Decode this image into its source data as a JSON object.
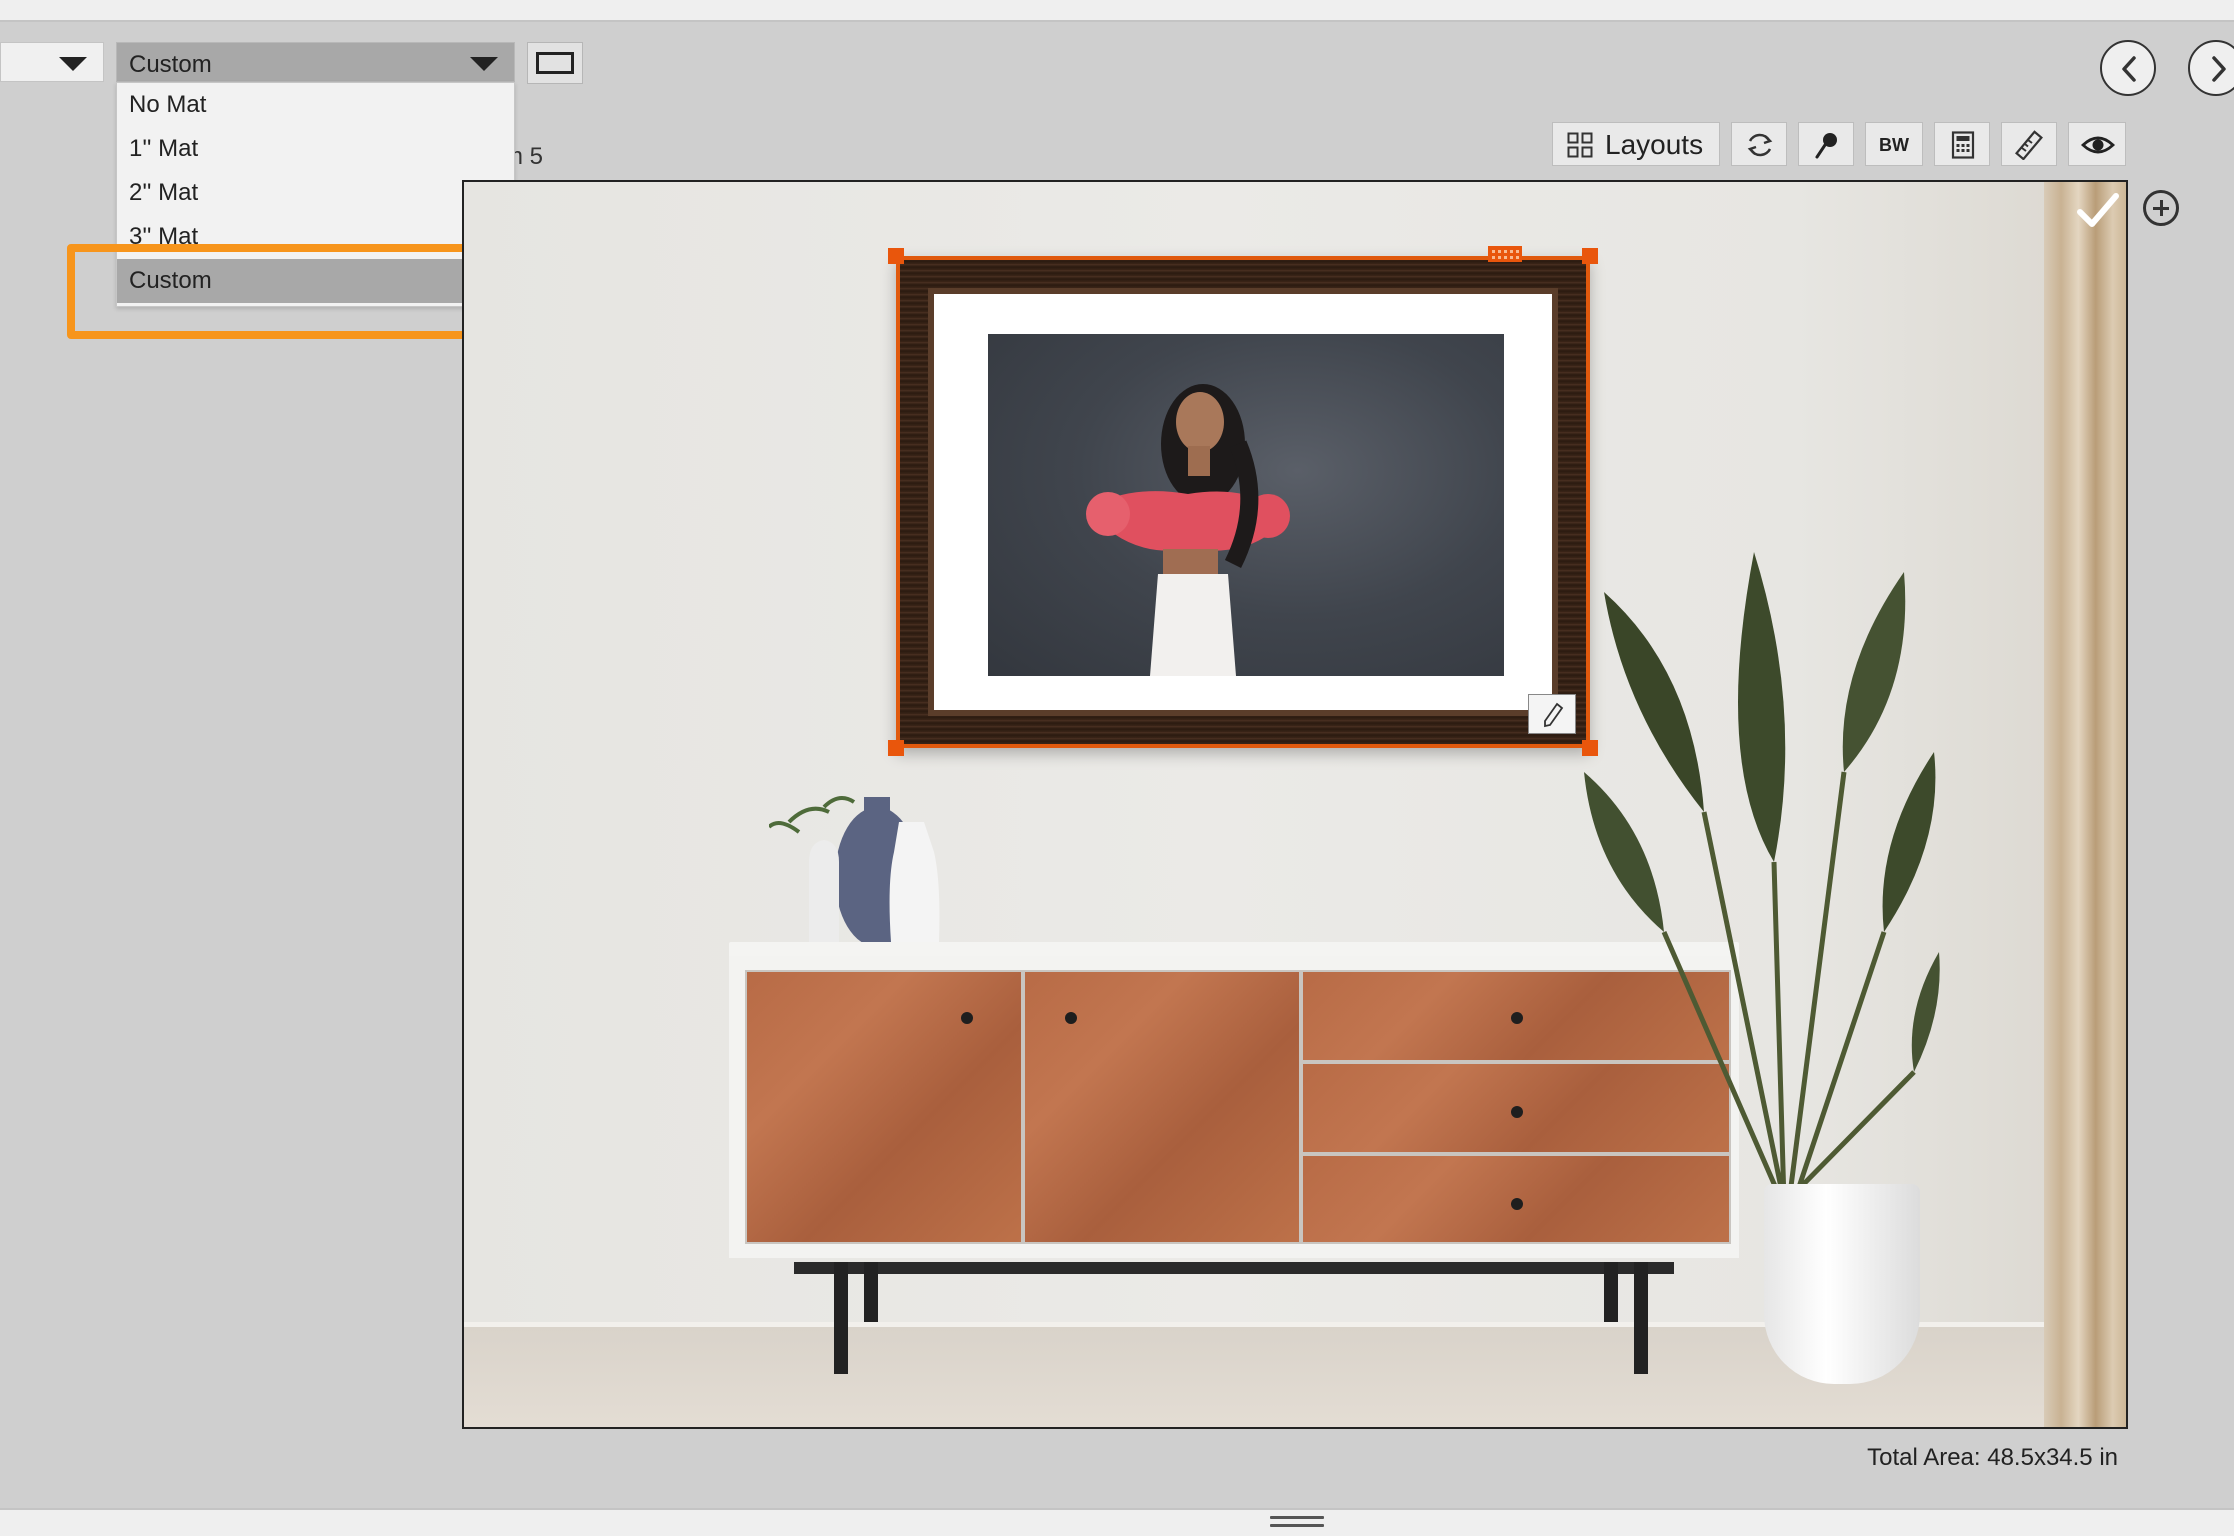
{
  "toolbar": {
    "left_select_value": "",
    "mat_select_value": "Custom",
    "layouts_label": "Layouts",
    "bw_label": "BW"
  },
  "mat_dropdown": {
    "options": [
      "No Mat",
      "1'' Mat",
      "2'' Mat",
      "3'' Mat",
      "Custom"
    ],
    "selected": "Custom"
  },
  "room_label": "m 5",
  "footer": {
    "total_area": "Total Area: 48.5x34.5 in"
  },
  "colors": {
    "selection_handles": "#e9560c",
    "highlight_outline": "#f7951c",
    "selected_option_bg": "#a8a8a8"
  },
  "icons": {
    "prev": "chevron-left-icon",
    "next": "chevron-right-icon",
    "layouts": "grid-icon",
    "rotate": "refresh-icon",
    "pin": "pin-icon",
    "calculator": "calculator-icon",
    "ruler": "ruler-icon",
    "eye": "eye-icon",
    "confirm": "checkmark-icon",
    "add": "plus-circle-icon",
    "edit": "pencil-icon"
  }
}
